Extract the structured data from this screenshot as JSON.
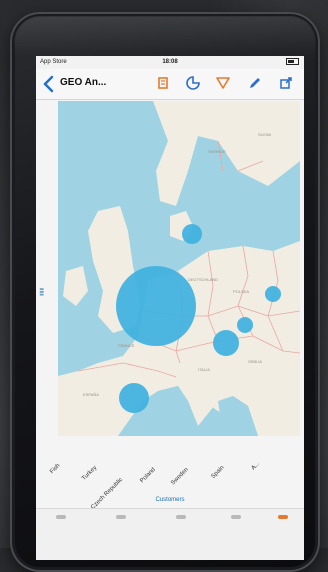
{
  "status_bar": {
    "carrier": "App Store",
    "time": "18:08"
  },
  "nav": {
    "title": "GEO An..."
  },
  "map": {
    "bubbles": [
      {
        "name": "Denmark",
        "size": 9
      },
      {
        "name": "United Kingdom",
        "size": 38
      },
      {
        "name": "Poland",
        "size": 7
      },
      {
        "name": "Czech Republic",
        "size": 7
      },
      {
        "name": "Austria",
        "size": 12
      },
      {
        "name": "Spain",
        "size": 14
      }
    ],
    "colors": {
      "water": "#9fd3e3",
      "land": "#f1ede3",
      "bubble": "#3fb1df",
      "border": "#e9a7a0"
    }
  },
  "x_axis": {
    "labels": [
      "Fish",
      "Turkey",
      "Czech Republic",
      "Poland",
      "Sweden",
      "Spain",
      "A..."
    ],
    "title": "Customers"
  },
  "icons": [
    "back-icon",
    "flag-icon",
    "tag-icon",
    "filter-icon",
    "pencil-icon",
    "share-icon"
  ]
}
